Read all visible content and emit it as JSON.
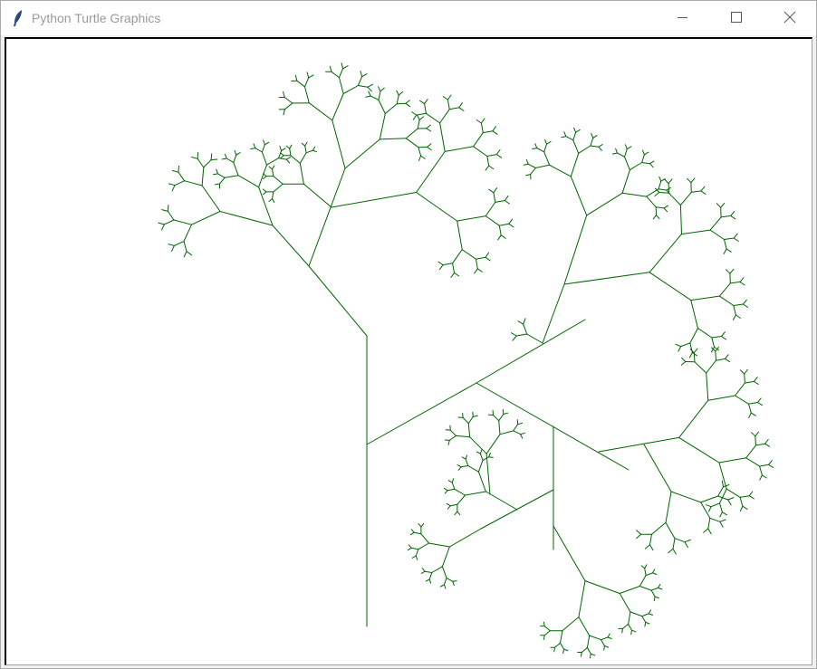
{
  "window": {
    "title": "Python Turtle Graphics",
    "app_icon": "feather-icon",
    "controls": {
      "minimize_icon": "minimize-icon",
      "maximize_icon": "maximize-icon",
      "close_icon": "close-icon"
    }
  },
  "canvas": {
    "background": "#ffffff",
    "pen_color": "#006400",
    "drawing": "fractal-tree"
  }
}
